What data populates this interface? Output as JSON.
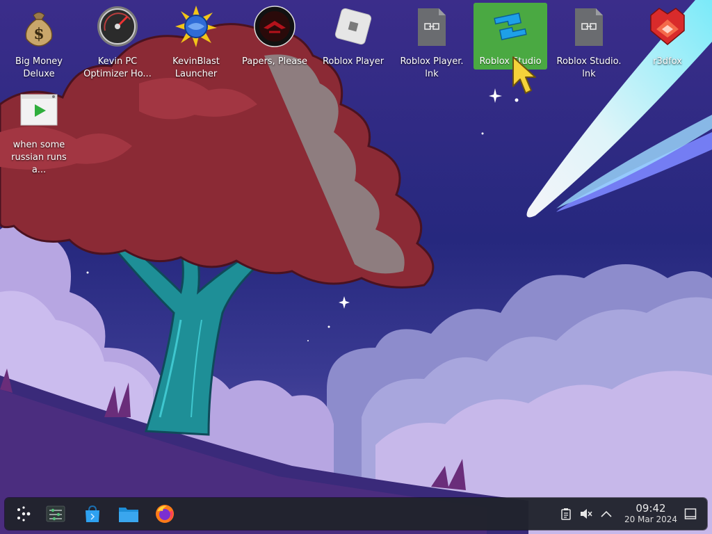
{
  "desktop": {
    "icons": [
      {
        "label": "Big Money\nDeluxe",
        "icon": "money-bag-icon"
      },
      {
        "label": "Kevin PC\nOptimizer Ho...",
        "icon": "speedometer-icon"
      },
      {
        "label": "KevinBlast\nLauncher",
        "icon": "blast-globe-icon"
      },
      {
        "label": "Papers, Please",
        "icon": "papers-please-icon"
      },
      {
        "label": "Roblox Player",
        "icon": "roblox-player-icon"
      },
      {
        "label": "Roblox Player.\nlnk",
        "icon": "shortcut-file-icon"
      },
      {
        "label": "Roblox Studio",
        "icon": "roblox-studio-icon"
      },
      {
        "label": "Roblox Studio.\nlnk",
        "icon": "shortcut-file-icon"
      },
      {
        "label": "r3dfox",
        "icon": "r3dfox-icon"
      },
      {
        "label": "when some\nrussian runs a...",
        "icon": "video-file-icon"
      }
    ],
    "selected_icon": "Roblox Studio"
  },
  "taskbar": {
    "launchers": [
      {
        "name": "Application Launcher",
        "icon": "app-launcher-icon"
      },
      {
        "name": "System Settings",
        "icon": "settings-sliders-icon"
      },
      {
        "name": "Discover",
        "icon": "store-bag-icon"
      },
      {
        "name": "Dolphin",
        "icon": "folder-icon"
      },
      {
        "name": "Firefox",
        "icon": "firefox-icon"
      }
    ],
    "tray": [
      {
        "name": "Clipboard",
        "icon": "clipboard-icon"
      },
      {
        "name": "Volume",
        "icon": "volume-muted-icon"
      },
      {
        "name": "Show hidden icons",
        "icon": "chevron-up-icon"
      }
    ],
    "clock": {
      "time": "09:42",
      "date": "20 Mar 2024"
    },
    "show_desktop_icon": "show-desktop-icon"
  },
  "colors": {
    "selection": "#4cb43c",
    "taskbar": "#20232c",
    "sky": "#2b2a86",
    "tree_foliage": "#8b2a35",
    "trunk": "#1f9aa0",
    "cloud": "#a99ad6"
  }
}
